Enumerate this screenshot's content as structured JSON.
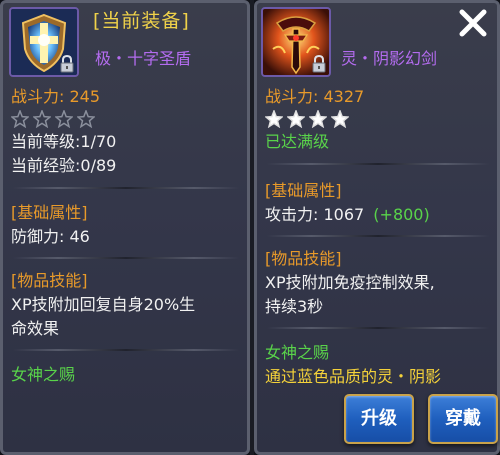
{
  "left": {
    "title": "[当前装备]",
    "item_name": "极・十字圣盾",
    "power_label": "战斗力: 245",
    "stars_filled": 0,
    "stars_total": 4,
    "level": "当前等级:1/70",
    "exp": "当前经验:0/89",
    "attr_header": "[基础属性]",
    "attr_value": "防御力: 46",
    "skill_header": "[物品技能]",
    "skill_line1": "XP技附加回复自身20%生",
    "skill_line2": "命效果",
    "blessing_header": "女神之赐"
  },
  "right": {
    "item_name": "灵・阴影幻剑",
    "power_label": "战斗力: 4327",
    "stars_filled": 4,
    "stars_total": 4,
    "max_level": "已达满级",
    "attr_header": "[基础属性]",
    "attr_value": "攻击力: 1067",
    "attr_bonus": "(+800)",
    "skill_header": "[物品技能]",
    "skill_line1": "XP技附加免疫控制效果,",
    "skill_line2": "持续3秒",
    "blessing_header": "女神之赐",
    "blessing_text": "通过蓝色品质的灵・阴影"
  },
  "buttons": {
    "upgrade": "升级",
    "equip": "穿戴"
  },
  "icons": {
    "left_item": "cross-shield-icon",
    "right_item": "shadow-sword-icon",
    "lock": "lock-icon",
    "close": "close-icon",
    "star": "star-icon"
  },
  "colors": {
    "orange_text": "#e89a2a",
    "purple_text": "#b46cf0",
    "green_text": "#59d34a",
    "title_gold": "#f0d24a"
  }
}
